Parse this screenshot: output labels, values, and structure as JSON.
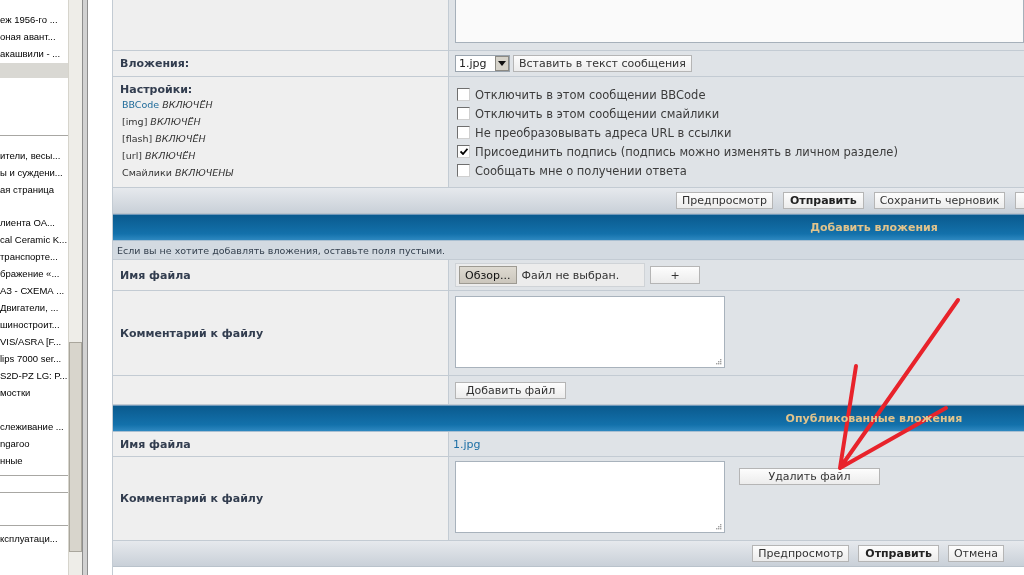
{
  "sidebar": {
    "sections": [
      {
        "items": [
          {
            "text": "еж 1956-го ...",
            "selected": false
          },
          {
            "text": "оная авант...",
            "selected": false
          },
          {
            "text": "акашвили - ...",
            "selected": false
          },
          {
            "selected": true
          }
        ]
      },
      {
        "items": [
          {
            "text": "ители, весы...",
            "selected": false
          },
          {
            "text": "ы и суждени...",
            "selected": false
          },
          {
            "text": "ая страница",
            "selected": false
          }
        ]
      },
      {
        "items": [
          {
            "text": "лиента ОА...",
            "selected": false
          },
          {
            "text": "cal Ceramic K...",
            "selected": false
          },
          {
            "text": "транспорте...",
            "selected": false
          },
          {
            "text": "бражение «...",
            "selected": false
          },
          {
            "text": "АЗ - СХЕМА ...",
            "selected": false
          },
          {
            "text": "Двигатели, ...",
            "selected": false
          },
          {
            "text": "шиностроит...",
            "selected": false
          },
          {
            "text": "VIS/ASRA [F...",
            "selected": false
          },
          {
            "text": "lips 7000 ser...",
            "selected": false
          },
          {
            "text": "S2D-PZ LG: P...",
            "selected": false
          },
          {
            "text": "мостки",
            "selected": false
          }
        ]
      },
      {
        "items": [
          {
            "text": "слеживание ...",
            "selected": false
          },
          {
            "text": "ngaroo",
            "selected": false
          },
          {
            "text": "нные",
            "selected": false
          }
        ]
      },
      {
        "items": [
          {
            "text": "ксплуатаци...",
            "selected": false
          }
        ]
      }
    ]
  },
  "attachments_row": {
    "label": "Вложения:",
    "selected_file": "1.jpg",
    "insert_button": "Вставить в текст сообщения"
  },
  "settings_row": {
    "label": "Настройки:",
    "statuses": [
      {
        "kind": "link",
        "name": "BBCode",
        "state": "ВКЛЮЧЁН"
      },
      {
        "kind": "text",
        "name": "[img]",
        "state": "ВКЛЮЧЁН"
      },
      {
        "kind": "text",
        "name": "[flash]",
        "state": "ВКЛЮЧЁН"
      },
      {
        "kind": "text",
        "name": "[url]",
        "state": "ВКЛЮЧЁН"
      },
      {
        "kind": "text",
        "name": "Смайлики",
        "state": "ВКЛЮЧЕНЫ"
      }
    ],
    "options": [
      {
        "label": "Отключить в этом сообщении BBCode",
        "checked": false
      },
      {
        "label": "Отключить в этом сообщении смайлики",
        "checked": false
      },
      {
        "label": "Не преобразовывать адреса URL в ссылки",
        "checked": false
      },
      {
        "label": "Присоединить подпись (подпись можно изменять в личном разделе)",
        "checked": true
      },
      {
        "label": "Сообщать мне о получении ответа",
        "checked": false
      }
    ]
  },
  "top_actions": [
    {
      "label": "Предпросмотр",
      "primary": false
    },
    {
      "label": "Отправить",
      "primary": true
    },
    {
      "label": "Сохранить черновик",
      "primary": false
    }
  ],
  "add_attachments": {
    "title": "Добавить вложения",
    "note": "Если вы не хотите добавлять вложения, оставьте поля пустыми.",
    "file_label": "Имя файла",
    "browse_button": "Обзор...",
    "file_status": "Файл не выбран.",
    "add_field_button": "+",
    "comment_label": "Комментарий к файлу",
    "add_file_button": "Добавить файл"
  },
  "posted_attachments": {
    "title": "Опубликованные вложения",
    "file_label": "Имя файла",
    "file_name": "1.jpg",
    "comment_label": "Комментарий к файлу",
    "delete_button": "Удалить файл"
  },
  "bottom_actions": [
    {
      "label": "Предпросмотр",
      "primary": false
    },
    {
      "label": "Отправить",
      "primary": true
    },
    {
      "label": "Отмена",
      "primary": false
    }
  ]
}
